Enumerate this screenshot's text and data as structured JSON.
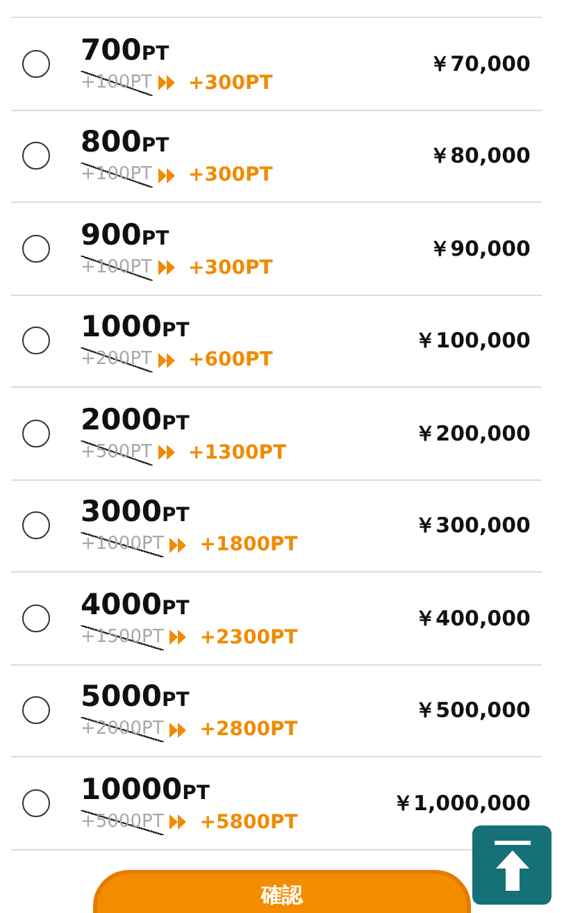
{
  "plans": [
    {
      "amount": "700",
      "unit": "PT",
      "old_bonus": "+100PT",
      "bonus": "+300PT",
      "price": "￥70,000",
      "selected": false
    },
    {
      "amount": "800",
      "unit": "PT",
      "old_bonus": "+100PT",
      "bonus": "+300PT",
      "price": "￥80,000",
      "selected": false
    },
    {
      "amount": "900",
      "unit": "PT",
      "old_bonus": "+100PT",
      "bonus": "+300PT",
      "price": "￥90,000",
      "selected": false
    },
    {
      "amount": "1000",
      "unit": "PT",
      "old_bonus": "+200PT",
      "bonus": "+600PT",
      "price": "￥100,000",
      "selected": false
    },
    {
      "amount": "2000",
      "unit": "PT",
      "old_bonus": "+500PT",
      "bonus": "+1300PT",
      "price": "￥200,000",
      "selected": false
    },
    {
      "amount": "3000",
      "unit": "PT",
      "old_bonus": "+1000PT",
      "bonus": "+1800PT",
      "price": "￥300,000",
      "selected": false
    },
    {
      "amount": "4000",
      "unit": "PT",
      "old_bonus": "+1500PT",
      "bonus": "+2300PT",
      "price": "￥400,000",
      "selected": false
    },
    {
      "amount": "5000",
      "unit": "PT",
      "old_bonus": "+2000PT",
      "bonus": "+2800PT",
      "price": "￥500,000",
      "selected": false
    },
    {
      "amount": "10000",
      "unit": "PT",
      "old_bonus": "+5000PT",
      "bonus": "+5800PT",
      "price": "￥1,000,000",
      "selected": false
    }
  ],
  "confirm_button": "確認"
}
